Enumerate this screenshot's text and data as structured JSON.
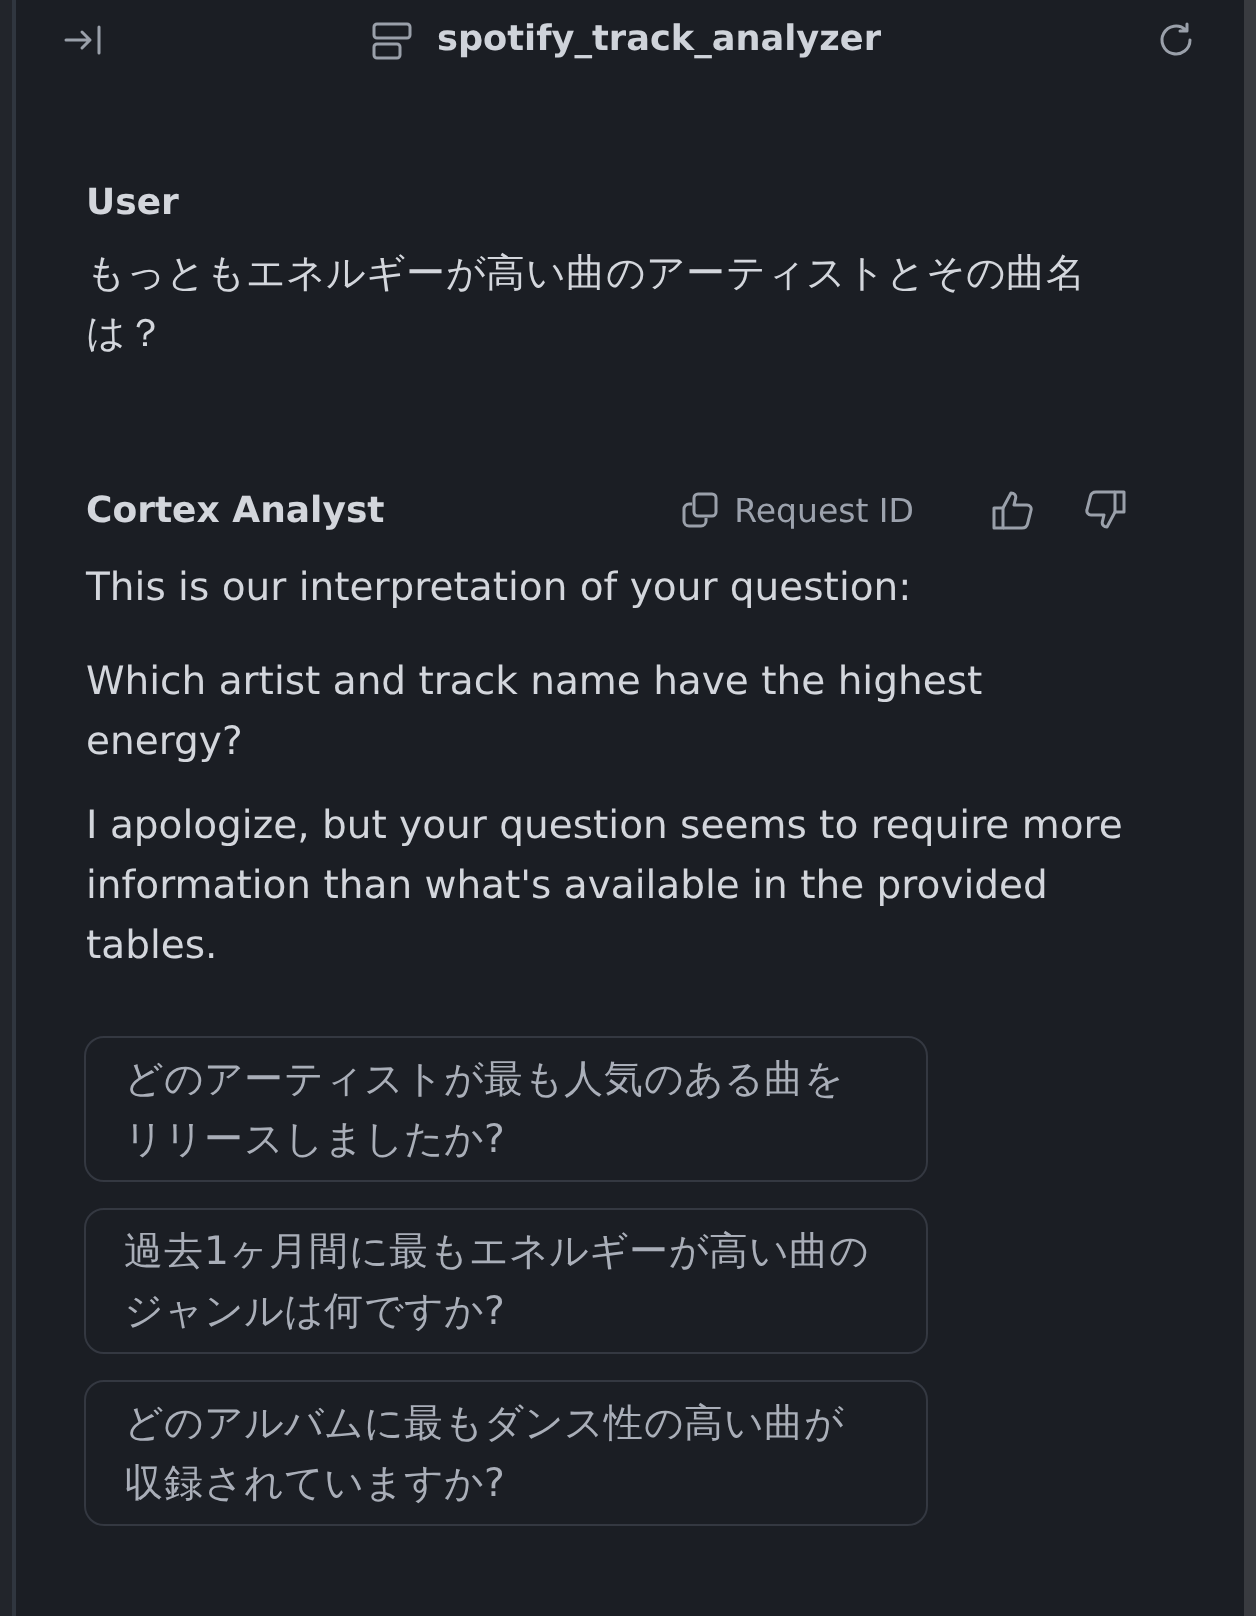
{
  "header": {
    "title": "spotify_track_analyzer"
  },
  "messages": [
    {
      "kind": "user",
      "author": "User",
      "paragraphs": [
        "もっともエネルギーが高い曲のアーティストとその曲名は？"
      ]
    },
    {
      "kind": "assistant",
      "author": "Cortex Analyst",
      "request_id_label": "Request ID",
      "paragraphs": [
        "This is our interpretation of your question:",
        "Which artist and track name have the highest energy?",
        "I apologize, but your question seems to require more information than what's available in the provided tables."
      ],
      "suggestions": [
        "どのアーティストが最も人気のある曲をリリースしましたか?",
        "過去1ヶ月間に最もエネルギーが高い曲のジャンルは何ですか?",
        "どのアルバムに最もダンス性の高い曲が収録されていますか?"
      ]
    }
  ]
}
